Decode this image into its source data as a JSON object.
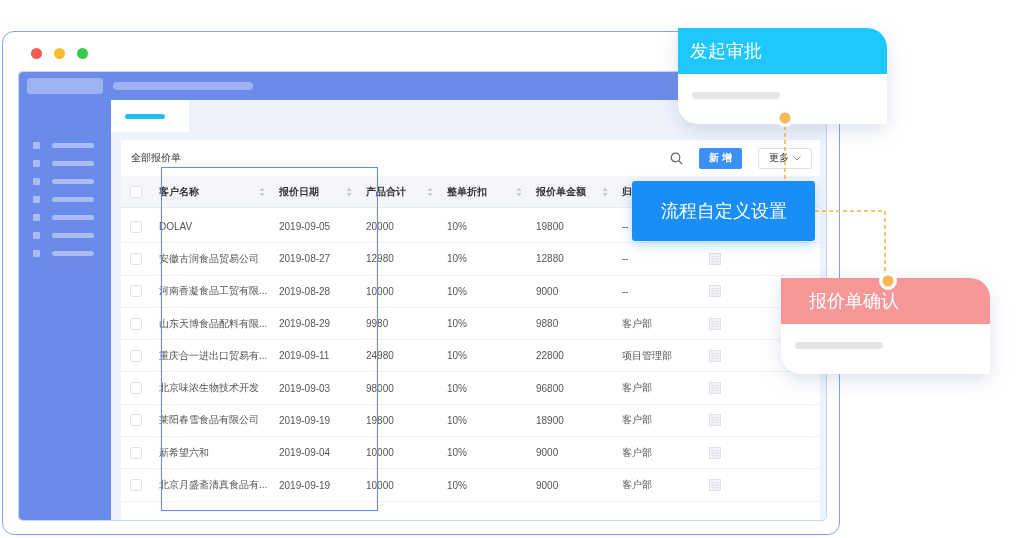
{
  "list_title": "全部报价单",
  "toolbar": {
    "add_button": "新 增",
    "more_button": "更多"
  },
  "table": {
    "header_checked": false,
    "columns": [
      "客户名称",
      "报价日期",
      "产品合计",
      "整单折扣",
      "报价单金额",
      "归"
    ],
    "rows": [
      {
        "checked": false,
        "cells": [
          "DOLAV",
          "2019-09-05",
          "20000",
          "10%",
          "19800",
          "--"
        ]
      },
      {
        "checked": false,
        "cells": [
          "安徽古润食品贸易公司",
          "2019-08-27",
          "12980",
          "10%",
          "12880",
          "--"
        ]
      },
      {
        "checked": false,
        "cells": [
          "河南香凝食品工贸有限...",
          "2019-08-28",
          "10000",
          "10%",
          "9000",
          "--"
        ]
      },
      {
        "checked": false,
        "cells": [
          "山东天博食品配料有限...",
          "2019-08-29",
          "9980",
          "10%",
          "9880",
          "客户部"
        ]
      },
      {
        "checked": false,
        "cells": [
          "重庆合一进出口贸易有...",
          "2019-09-11",
          "24980",
          "10%",
          "22800",
          "项目管理部"
        ]
      },
      {
        "checked": false,
        "cells": [
          "北京味浓生物技术开发",
          "2019-09-03",
          "98000",
          "10%",
          "96800",
          "客户部"
        ]
      },
      {
        "checked": false,
        "cells": [
          "莱阳春雪食品有限公司",
          "2019-09-19",
          "19800",
          "10%",
          "18900",
          "客户部"
        ]
      },
      {
        "checked": false,
        "cells": [
          "新希望六和",
          "2019-09-04",
          "10000",
          "10%",
          "9000",
          "客户部"
        ]
      },
      {
        "checked": false,
        "cells": [
          "北京月盛斋清真食品有...",
          "2019-09-19",
          "10000",
          "10%",
          "9000",
          "客户部"
        ]
      }
    ]
  },
  "flow_nodes": [
    {
      "kind": "card",
      "label": "发起审批",
      "color": "#1ec8ff"
    },
    {
      "kind": "box",
      "label": "流程自定义设置"
    },
    {
      "kind": "card",
      "label": "报价单确认",
      "color": "#f59797"
    }
  ]
}
